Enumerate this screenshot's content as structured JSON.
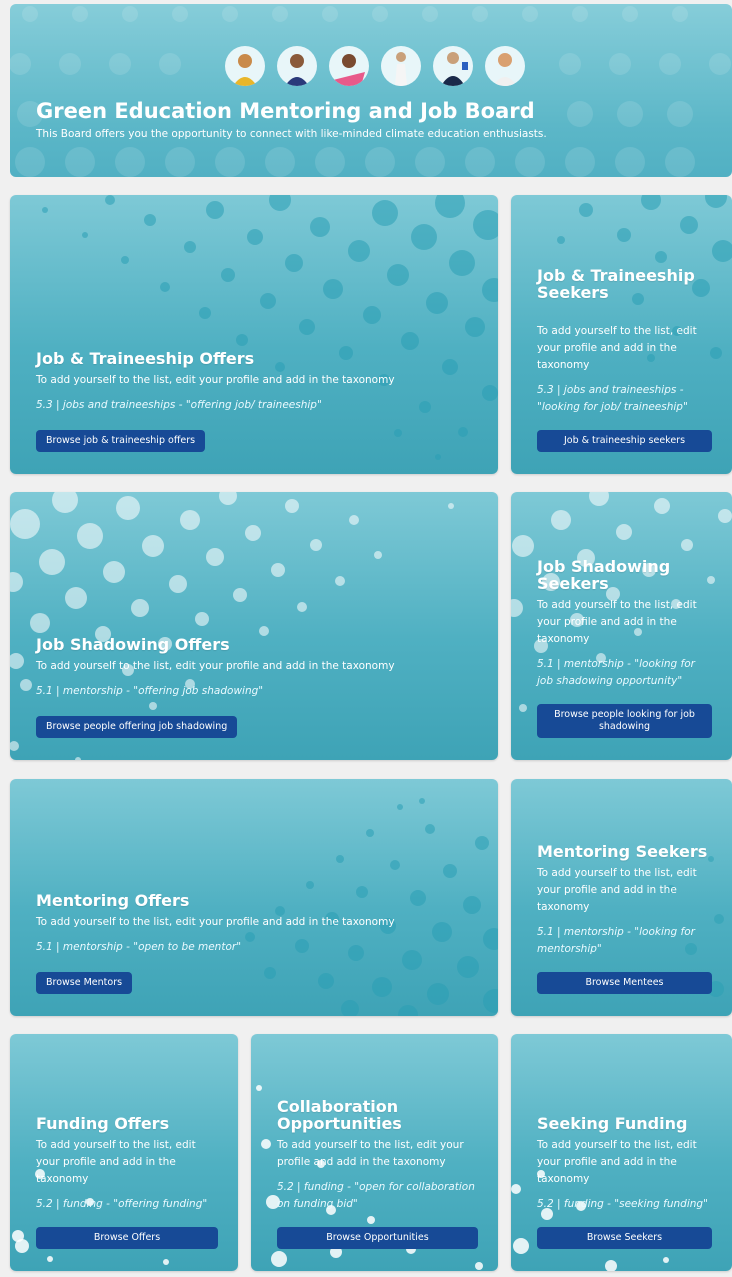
{
  "header": {
    "title": "Green Education Mentoring and Job Board",
    "subtitle": "This Board offers you the opportunity to connect with like-minded climate education enthusiasts."
  },
  "cards": {
    "job_offers": {
      "title": "Job & Traineeship Offers",
      "desc": "To add yourself to the list, edit your profile and add in the taxonomy",
      "taxonomy": "5.3 | jobs and traineeships - \"offering job/ traineeship\"",
      "button": "Browse job & traineeship offers"
    },
    "job_seekers": {
      "title": "Job & Traineeship Seekers",
      "desc": "To add yourself to the list, edit your profile and add in the taxonomy",
      "taxonomy": "5.3 | jobs and traineeships - \"looking for job/ traineeship\"",
      "button": "Job & traineeship seekers"
    },
    "shadowing_offers": {
      "title": "Job Shadowing Offers",
      "desc": "To add yourself to the list, edit your profile and add in the taxonomy",
      "taxonomy": "5.1 | mentorship - \"offering job shadowing\"",
      "button": "Browse people offering job shadowing"
    },
    "shadowing_seekers": {
      "title": "Job Shadowing Seekers",
      "desc": "To add yourself to the list, edit your profile and add in the taxonomy",
      "taxonomy": "5.1 | mentorship - \"looking for job shadowing opportunity\"",
      "button": "Browse people looking for job shadowing"
    },
    "mentoring_offers": {
      "title": "Mentoring Offers",
      "desc": "To add yourself to the list, edit your profile and add in the taxonomy",
      "taxonomy": "5.1 | mentorship - \"open to be mentor\"",
      "button": "Browse Mentors"
    },
    "mentoring_seekers": {
      "title": "Mentoring Seekers",
      "desc": "To add yourself to the list, edit your profile and add in the taxonomy",
      "taxonomy": "5.1 | mentorship - \"looking for mentorship\"",
      "button": "Browse Mentees"
    },
    "funding_offers": {
      "title": "Funding Offers",
      "desc": "To add yourself to the list, edit your profile and add in the taxonomy",
      "taxonomy": "5.2 | funding - \"offering funding\"",
      "button": "Browse Offers"
    },
    "collaboration": {
      "title": "Collaboration Opportunities",
      "desc": "To add yourself to the list, edit your profile and add in the taxonomy",
      "taxonomy": "5.2 | funding - \"open for collaboration on funding bid\"",
      "button": "Browse Opportunities"
    },
    "seeking_funding": {
      "title": "Seeking Funding",
      "desc": "To add yourself to the list, edit your profile and add in the taxonomy",
      "taxonomy": "5.2 | funding - \"seeking funding\"",
      "button": "Browse Seekers"
    }
  },
  "colors": {
    "card_gradient_top": "#7ec9d6",
    "card_gradient_bottom": "#3ea3b6",
    "button": "#174a96",
    "dots_teal": "#2a9fb4",
    "dots_white": "#ffffff"
  }
}
